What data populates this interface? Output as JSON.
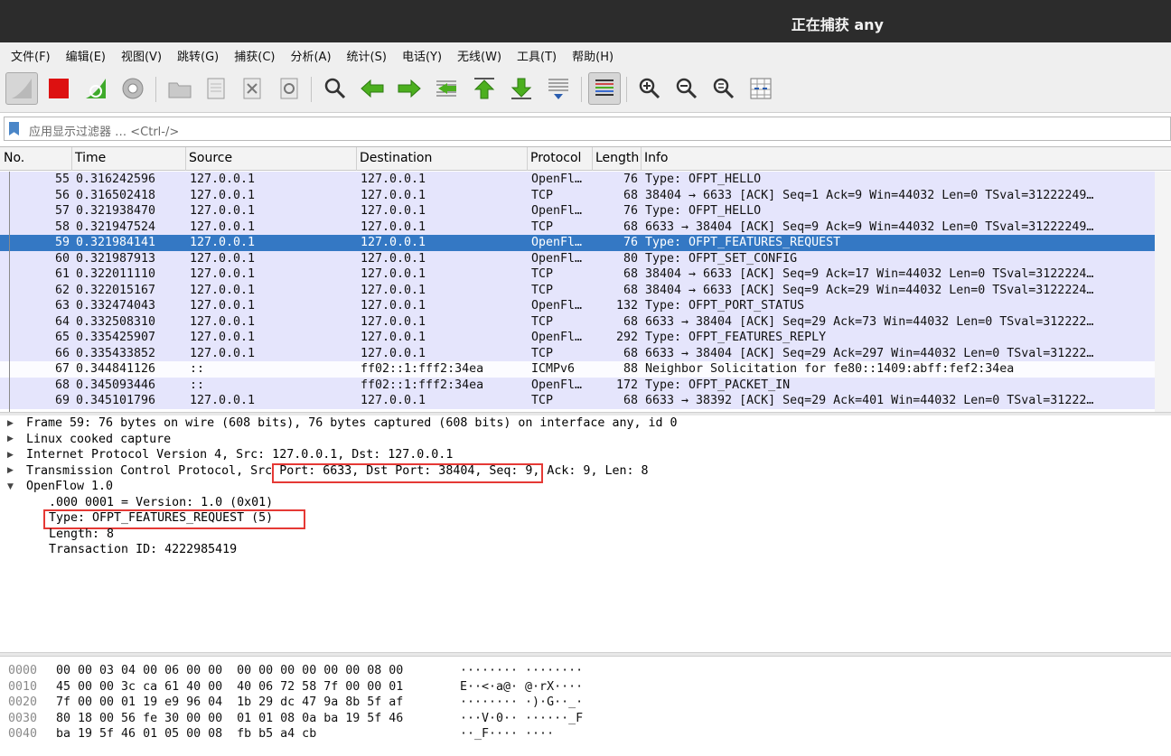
{
  "window": {
    "title": "正在捕获 any"
  },
  "menu": [
    "文件(F)",
    "编辑(E)",
    "视图(V)",
    "跳转(G)",
    "捕获(C)",
    "分析(A)",
    "统计(S)",
    "电话(Y)",
    "无线(W)",
    "工具(T)",
    "帮助(H)"
  ],
  "toolbar": {
    "icons": [
      "shark-fin-start-icon",
      "stop-capture-icon",
      "restart-capture-icon",
      "capture-options-icon",
      "open-file-icon",
      "save-file-icon",
      "close-file-icon",
      "reload-file-icon",
      "find-packet-icon",
      "go-back-icon",
      "go-forward-icon",
      "go-to-packet-icon",
      "go-first-icon",
      "go-last-icon",
      "autoscroll-icon",
      "colorize-icon",
      "zoom-in-icon",
      "zoom-out-icon",
      "normal-size-icon",
      "resize-columns-icon"
    ]
  },
  "filter": {
    "placeholder": "应用显示过滤器 … <Ctrl-/>"
  },
  "packet_list": {
    "headers": {
      "no": "No.",
      "time": "Time",
      "source": "Source",
      "destination": "Destination",
      "protocol": "Protocol",
      "length": "Length",
      "info": "Info"
    },
    "rows": [
      {
        "no": "55",
        "time": "0.316242596",
        "src": "127.0.0.1",
        "dst": "127.0.0.1",
        "proto": "OpenFl…",
        "len": "76",
        "info": "Type: OFPT_HELLO",
        "style": ""
      },
      {
        "no": "56",
        "time": "0.316502418",
        "src": "127.0.0.1",
        "dst": "127.0.0.1",
        "proto": "TCP",
        "len": "68",
        "info": "38404 → 6633 [ACK] Seq=1 Ack=9 Win=44032 Len=0 TSval=31222249…",
        "style": ""
      },
      {
        "no": "57",
        "time": "0.321938470",
        "src": "127.0.0.1",
        "dst": "127.0.0.1",
        "proto": "OpenFl…",
        "len": "76",
        "info": "Type: OFPT_HELLO",
        "style": ""
      },
      {
        "no": "58",
        "time": "0.321947524",
        "src": "127.0.0.1",
        "dst": "127.0.0.1",
        "proto": "TCP",
        "len": "68",
        "info": "6633 → 38404 [ACK] Seq=9 Ack=9 Win=44032 Len=0 TSval=31222249…",
        "style": ""
      },
      {
        "no": "59",
        "time": "0.321984141",
        "src": "127.0.0.1",
        "dst": "127.0.0.1",
        "proto": "OpenFl…",
        "len": "76",
        "info": "Type: OFPT_FEATURES_REQUEST",
        "style": "sel"
      },
      {
        "no": "60",
        "time": "0.321987913",
        "src": "127.0.0.1",
        "dst": "127.0.0.1",
        "proto": "OpenFl…",
        "len": "80",
        "info": "Type: OFPT_SET_CONFIG",
        "style": ""
      },
      {
        "no": "61",
        "time": "0.322011110",
        "src": "127.0.0.1",
        "dst": "127.0.0.1",
        "proto": "TCP",
        "len": "68",
        "info": "38404 → 6633 [ACK] Seq=9 Ack=17 Win=44032 Len=0 TSval=3122224…",
        "style": ""
      },
      {
        "no": "62",
        "time": "0.322015167",
        "src": "127.0.0.1",
        "dst": "127.0.0.1",
        "proto": "TCP",
        "len": "68",
        "info": "38404 → 6633 [ACK] Seq=9 Ack=29 Win=44032 Len=0 TSval=3122224…",
        "style": ""
      },
      {
        "no": "63",
        "time": "0.332474043",
        "src": "127.0.0.1",
        "dst": "127.0.0.1",
        "proto": "OpenFl…",
        "len": "132",
        "info": "Type: OFPT_PORT_STATUS",
        "style": ""
      },
      {
        "no": "64",
        "time": "0.332508310",
        "src": "127.0.0.1",
        "dst": "127.0.0.1",
        "proto": "TCP",
        "len": "68",
        "info": "6633 → 38404 [ACK] Seq=29 Ack=73 Win=44032 Len=0 TSval=312222…",
        "style": ""
      },
      {
        "no": "65",
        "time": "0.335425907",
        "src": "127.0.0.1",
        "dst": "127.0.0.1",
        "proto": "OpenFl…",
        "len": "292",
        "info": "Type: OFPT_FEATURES_REPLY",
        "style": ""
      },
      {
        "no": "66",
        "time": "0.335433852",
        "src": "127.0.0.1",
        "dst": "127.0.0.1",
        "proto": "TCP",
        "len": "68",
        "info": "6633 → 38404 [ACK] Seq=29 Ack=297 Win=44032 Len=0 TSval=31222…",
        "style": ""
      },
      {
        "no": "67",
        "time": "0.344841126",
        "src": "::",
        "dst": "ff02::1:fff2:34ea",
        "proto": "ICMPv6",
        "len": "88",
        "info": "Neighbor Solicitation for fe80::1409:abff:fef2:34ea",
        "style": "icmp"
      },
      {
        "no": "68",
        "time": "0.345093446",
        "src": "::",
        "dst": "ff02::1:fff2:34ea",
        "proto": "OpenFl…",
        "len": "172",
        "info": "Type: OFPT_PACKET_IN",
        "style": ""
      },
      {
        "no": "69",
        "time": "0.345101796",
        "src": "127.0.0.1",
        "dst": "127.0.0.1",
        "proto": "TCP",
        "len": "68",
        "info": "6633 → 38392 [ACK] Seq=29 Ack=401 Win=44032 Len=0 TSval=31222…",
        "style": ""
      }
    ]
  },
  "details": {
    "frame": "Frame 59: 76 bytes on wire (608 bits), 76 bytes captured (608 bits) on interface any, id 0",
    "linux": "Linux cooked capture",
    "ip": "Internet Protocol Version 4, Src: 127.0.0.1, Dst: 127.0.0.1",
    "tcp_prefix": "Transmission Control Protocol, ",
    "tcp_ports": "Src Port: 6633, Dst Port: 38404,",
    "tcp_suffix": " Seq: 9, Ack: 9, Len: 8",
    "openflow": "OpenFlow 1.0",
    "version": ".000 0001 = Version: 1.0 (0x01)",
    "type": "Type: OFPT_FEATURES_REQUEST (5)",
    "length": "Length: 8",
    "xid": "Transaction ID: 4222985419"
  },
  "bytes": [
    {
      "off": "0000",
      "hex": "00 00 03 04 00 06 00 00  00 00 00 00 00 00 08 00",
      "ascii": "········ ········"
    },
    {
      "off": "0010",
      "hex": "45 00 00 3c ca 61 40 00  40 06 72 58 7f 00 00 01",
      "ascii": "E··<·a@· @·rX····"
    },
    {
      "off": "0020",
      "hex": "7f 00 00 01 19 e9 96 04  1b 29 dc 47 9a 8b 5f af",
      "ascii": "········ ·)·G··_·"
    },
    {
      "off": "0030",
      "hex": "80 18 00 56 fe 30 00 00  01 01 08 0a ba 19 5f 46",
      "ascii": "···V·0·· ······_F"
    },
    {
      "off": "0040",
      "hex": "ba 19 5f 46 01 05 00 08  fb b5 a4 cb",
      "ascii": "··_F···· ····"
    }
  ]
}
